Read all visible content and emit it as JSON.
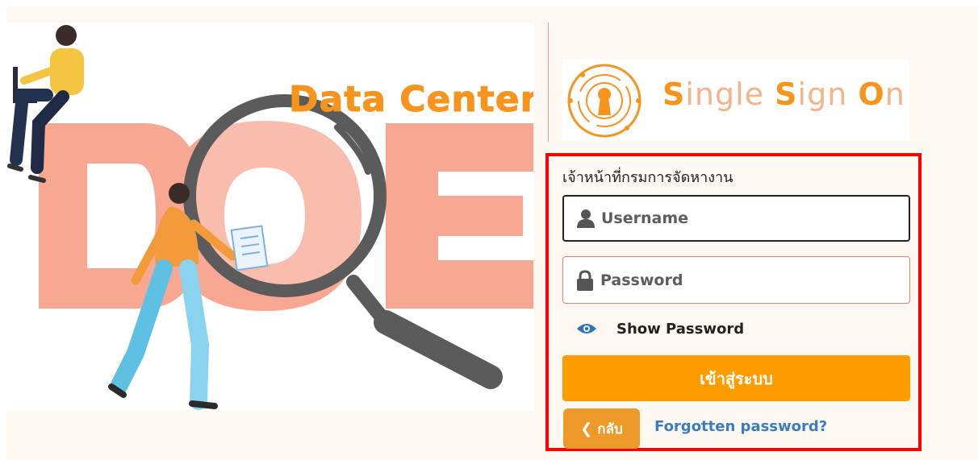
{
  "hero": {
    "title": "Data Center",
    "watermark": "DOE"
  },
  "sso_logo": {
    "text_parts": [
      "S",
      "ingle ",
      "S",
      "ign ",
      "O",
      "n"
    ]
  },
  "login": {
    "heading": "เจ้าหน้าที่กรมการจัดหางาน",
    "username_placeholder": "Username",
    "password_placeholder": "Password",
    "show_password_label": "Show Password",
    "submit_label": "เข้าสู่ระบบ",
    "back_label": "กลับ",
    "forgot_label": "Forgotten password?"
  },
  "icons": {
    "username": "user-icon",
    "password": "lock-icon",
    "show_password": "eye-icon",
    "back": "chevron-left-icon",
    "logo": "keyhole-icon"
  },
  "colors": {
    "accent": "#ff9c00",
    "brand_orange": "#f7941d",
    "highlight_border": "#ff0000",
    "link": "#3a7dbf"
  }
}
